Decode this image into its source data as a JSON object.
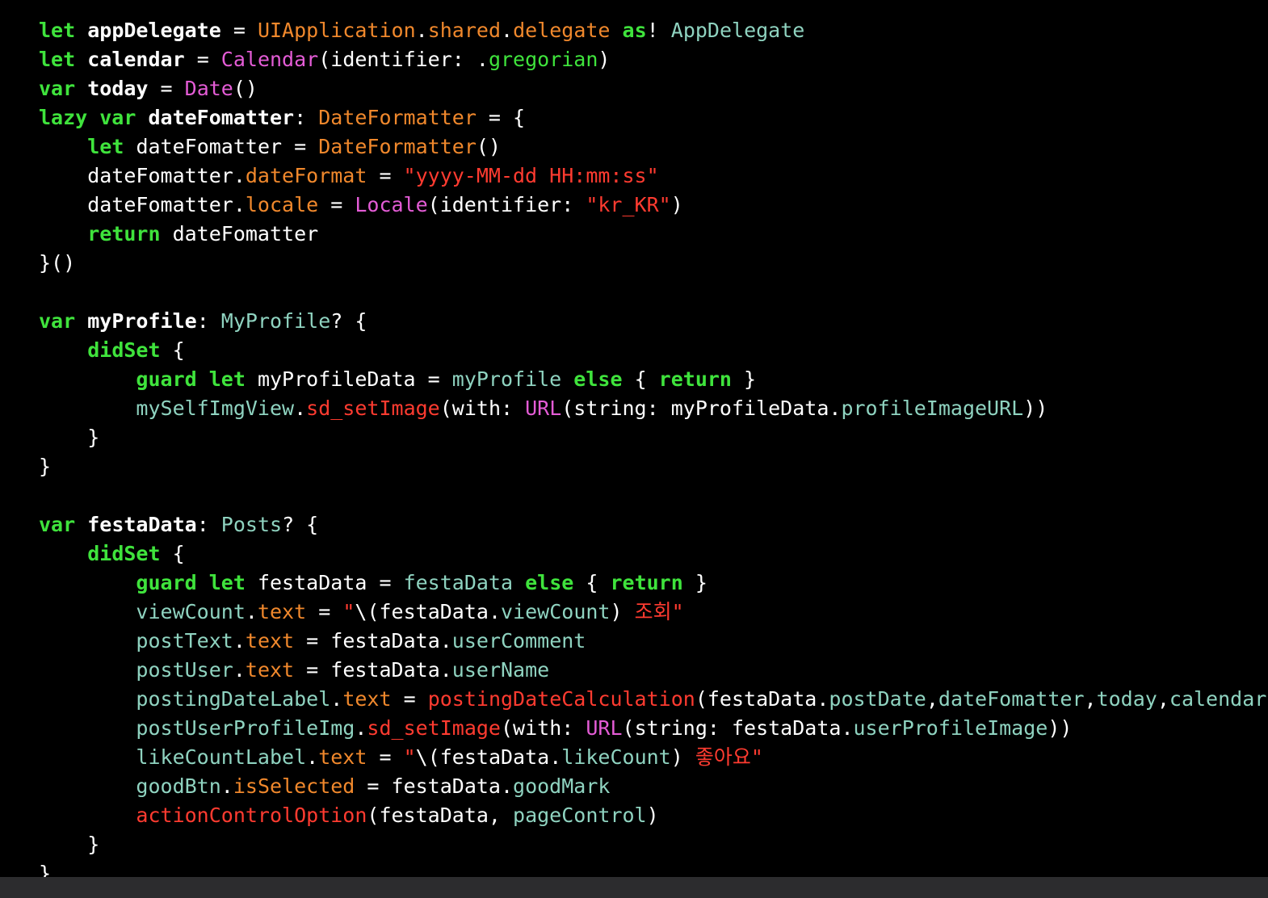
{
  "editor": {
    "colors": {
      "background": "#000000",
      "keyword": "#3fe33c",
      "type": "#f0882c",
      "class": "#e45cd6",
      "string": "#ff3b30",
      "property": "#8fd3c0",
      "plain": "#ffffff",
      "status_bar": "#2c2c2e"
    },
    "lines": [
      [
        [
          "kw",
          "let "
        ],
        [
          "decl",
          "appDelegate"
        ],
        [
          "plain",
          " = "
        ],
        [
          "type",
          "UIApplication"
        ],
        [
          "plain",
          "."
        ],
        [
          "type",
          "shared"
        ],
        [
          "plain",
          "."
        ],
        [
          "type",
          "delegate"
        ],
        [
          "plain",
          " "
        ],
        [
          "kw",
          "as"
        ],
        [
          "plain",
          "! "
        ],
        [
          "prop",
          "AppDelegate"
        ]
      ],
      [
        [
          "kw",
          "let "
        ],
        [
          "decl",
          "calendar"
        ],
        [
          "plain",
          " = "
        ],
        [
          "cls",
          "Calendar"
        ],
        [
          "plain",
          "(identifier: ."
        ],
        [
          "enum",
          "gregorian"
        ],
        [
          "plain",
          ")"
        ]
      ],
      [
        [
          "kw",
          "var "
        ],
        [
          "decl",
          "today"
        ],
        [
          "plain",
          " = "
        ],
        [
          "cls",
          "Date"
        ],
        [
          "plain",
          "()"
        ]
      ],
      [
        [
          "kw",
          "lazy var "
        ],
        [
          "decl",
          "dateFomatter"
        ],
        [
          "plain",
          ": "
        ],
        [
          "type",
          "DateFormatter"
        ],
        [
          "plain",
          " = {"
        ]
      ],
      [
        [
          "plain",
          "    "
        ],
        [
          "kw",
          "let "
        ],
        [
          "plain",
          "dateFomatter = "
        ],
        [
          "type",
          "DateFormatter"
        ],
        [
          "plain",
          "()"
        ]
      ],
      [
        [
          "plain",
          "    dateFomatter."
        ],
        [
          "member",
          "dateFormat"
        ],
        [
          "plain",
          " = "
        ],
        [
          "str",
          "\"yyyy-MM-dd HH:mm:ss\""
        ]
      ],
      [
        [
          "plain",
          "    dateFomatter."
        ],
        [
          "member",
          "locale"
        ],
        [
          "plain",
          " = "
        ],
        [
          "cls",
          "Locale"
        ],
        [
          "plain",
          "(identifier: "
        ],
        [
          "str",
          "\"kr_KR\""
        ],
        [
          "plain",
          ")"
        ]
      ],
      [
        [
          "plain",
          "    "
        ],
        [
          "kw",
          "return "
        ],
        [
          "plain",
          "dateFomatter"
        ]
      ],
      [
        [
          "plain",
          "}()"
        ]
      ],
      [
        [
          "plain",
          ""
        ]
      ],
      [
        [
          "kw",
          "var "
        ],
        [
          "decl",
          "myProfile"
        ],
        [
          "plain",
          ": "
        ],
        [
          "prop",
          "MyProfile"
        ],
        [
          "plain",
          "? {"
        ]
      ],
      [
        [
          "plain",
          "    "
        ],
        [
          "kw",
          "didSet"
        ],
        [
          "plain",
          " {"
        ]
      ],
      [
        [
          "plain",
          "        "
        ],
        [
          "kw",
          "guard let "
        ],
        [
          "plain",
          "myProfileData = "
        ],
        [
          "prop",
          "myProfile"
        ],
        [
          "plain",
          " "
        ],
        [
          "kw",
          "else"
        ],
        [
          "plain",
          " { "
        ],
        [
          "kw",
          "return"
        ],
        [
          "plain",
          " }"
        ]
      ],
      [
        [
          "plain",
          "        "
        ],
        [
          "prop",
          "mySelfImgView"
        ],
        [
          "plain",
          "."
        ],
        [
          "method",
          "sd_setImage"
        ],
        [
          "plain",
          "(with: "
        ],
        [
          "cls",
          "URL"
        ],
        [
          "plain",
          "(string: myProfileData."
        ],
        [
          "prop",
          "profileImageURL"
        ],
        [
          "plain",
          "))"
        ]
      ],
      [
        [
          "plain",
          "    }"
        ]
      ],
      [
        [
          "plain",
          "}"
        ]
      ],
      [
        [
          "plain",
          ""
        ]
      ],
      [
        [
          "kw",
          "var "
        ],
        [
          "decl",
          "festaData"
        ],
        [
          "plain",
          ": "
        ],
        [
          "prop",
          "Posts"
        ],
        [
          "plain",
          "? {"
        ]
      ],
      [
        [
          "plain",
          "    "
        ],
        [
          "kw",
          "didSet"
        ],
        [
          "plain",
          " {"
        ]
      ],
      [
        [
          "plain",
          "        "
        ],
        [
          "kw",
          "guard let "
        ],
        [
          "plain",
          "festaData = "
        ],
        [
          "prop",
          "festaData"
        ],
        [
          "plain",
          " "
        ],
        [
          "kw",
          "else"
        ],
        [
          "plain",
          " { "
        ],
        [
          "kw",
          "return"
        ],
        [
          "plain",
          " }"
        ]
      ],
      [
        [
          "plain",
          "        "
        ],
        [
          "prop",
          "viewCount"
        ],
        [
          "plain",
          "."
        ],
        [
          "member",
          "text"
        ],
        [
          "plain",
          " = "
        ],
        [
          "str",
          "\""
        ],
        [
          "plain",
          "\\(festaData."
        ],
        [
          "prop",
          "viewCount"
        ],
        [
          "plain",
          ") "
        ],
        [
          "str",
          "조회\""
        ]
      ],
      [
        [
          "plain",
          "        "
        ],
        [
          "prop",
          "postText"
        ],
        [
          "plain",
          "."
        ],
        [
          "member",
          "text"
        ],
        [
          "plain",
          " = festaData."
        ],
        [
          "prop",
          "userComment"
        ]
      ],
      [
        [
          "plain",
          "        "
        ],
        [
          "prop",
          "postUser"
        ],
        [
          "plain",
          "."
        ],
        [
          "member",
          "text"
        ],
        [
          "plain",
          " = festaData."
        ],
        [
          "prop",
          "userName"
        ]
      ],
      [
        [
          "plain",
          "        "
        ],
        [
          "prop",
          "postingDateLabel"
        ],
        [
          "plain",
          "."
        ],
        [
          "member",
          "text"
        ],
        [
          "plain",
          " = "
        ],
        [
          "method",
          "postingDateCalculation"
        ],
        [
          "plain",
          "(festaData."
        ],
        [
          "prop",
          "postDate"
        ],
        [
          "plain",
          ","
        ],
        [
          "prop",
          "dateFomatter"
        ],
        [
          "plain",
          ","
        ],
        [
          "prop",
          "today"
        ],
        [
          "plain",
          ","
        ],
        [
          "prop",
          "calendar"
        ],
        [
          "plain",
          ")"
        ]
      ],
      [
        [
          "plain",
          "        "
        ],
        [
          "prop",
          "postUserProfileImg"
        ],
        [
          "plain",
          "."
        ],
        [
          "method",
          "sd_setImage"
        ],
        [
          "plain",
          "(with: "
        ],
        [
          "cls",
          "URL"
        ],
        [
          "plain",
          "(string: festaData."
        ],
        [
          "prop",
          "userProfileImage"
        ],
        [
          "plain",
          "))"
        ]
      ],
      [
        [
          "plain",
          "        "
        ],
        [
          "prop",
          "likeCountLabel"
        ],
        [
          "plain",
          "."
        ],
        [
          "member",
          "text"
        ],
        [
          "plain",
          " = "
        ],
        [
          "str",
          "\""
        ],
        [
          "plain",
          "\\(festaData."
        ],
        [
          "prop",
          "likeCount"
        ],
        [
          "plain",
          ") "
        ],
        [
          "str",
          "좋아요\""
        ]
      ],
      [
        [
          "plain",
          "        "
        ],
        [
          "prop",
          "goodBtn"
        ],
        [
          "plain",
          "."
        ],
        [
          "member",
          "isSelected"
        ],
        [
          "plain",
          " = festaData."
        ],
        [
          "prop",
          "goodMark"
        ]
      ],
      [
        [
          "plain",
          "        "
        ],
        [
          "method",
          "actionControlOption"
        ],
        [
          "plain",
          "(festaData, "
        ],
        [
          "prop",
          "pageControl"
        ],
        [
          "plain",
          ")"
        ]
      ],
      [
        [
          "plain",
          "    }"
        ]
      ],
      [
        [
          "plain",
          "}"
        ]
      ]
    ]
  }
}
